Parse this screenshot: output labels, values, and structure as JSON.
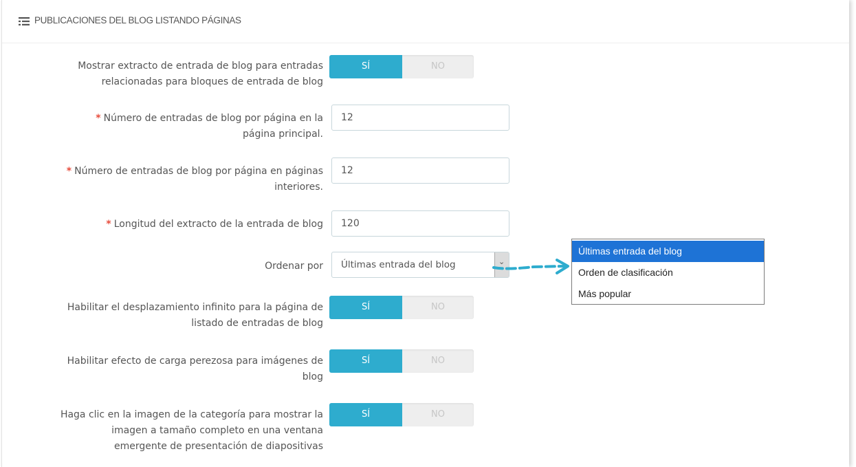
{
  "section": {
    "title": "PUBLICACIONES DEL BLOG LISTANDO PÁGINAS",
    "icon": "list-icon"
  },
  "fields": {
    "excerpt_related": {
      "label_lines": [
        "Mostrar extracto de entrada de blog para entradas",
        "relacionadas para bloques de entrada de blog"
      ],
      "on_label": "SÍ",
      "off_label": "NO",
      "value": "SÍ"
    },
    "posts_per_page_main": {
      "required_mark": "*",
      "label_lines": [
        "Número de entradas de blog por página en la",
        "página principal."
      ],
      "value": "12"
    },
    "posts_per_page_inner": {
      "required_mark": "*",
      "label_lines": [
        "Número de entradas de blog por página en páginas",
        "interiores."
      ],
      "value": "12"
    },
    "excerpt_length": {
      "required_mark": "*",
      "label": "Longitud del extracto de la entrada de blog",
      "value": "120"
    },
    "order_by": {
      "label": "Ordenar por",
      "value": "Últimas entrada del blog",
      "arrow_glyph": "⌄"
    },
    "infinite_scroll": {
      "label_lines": [
        "Habilitar el desplazamiento infinito para la página de",
        "listado de entradas de blog"
      ],
      "on_label": "SÍ",
      "off_label": "NO",
      "value": "SÍ"
    },
    "lazy_load": {
      "label_lines": [
        "Habilitar efecto de carga perezosa para imágenes de",
        "blog"
      ],
      "on_label": "SÍ",
      "off_label": "NO",
      "value": "SÍ"
    },
    "category_image_popup": {
      "label_lines": [
        "Haga clic en la imagen de la categoría para mostrar la",
        "imagen a tamaño completo en una ventana",
        "emergente de presentación de diapositivas"
      ],
      "on_label": "SÍ",
      "off_label": "NO",
      "value": "SÍ"
    }
  },
  "dropdown": {
    "options": [
      "Últimas entrada del blog",
      "Orden de clasificación",
      "Más popular"
    ],
    "selected": "Últimas entrada del blog"
  },
  "colors": {
    "switch_on": "#2eacce",
    "required": "#e74c3c",
    "dropdown_highlight": "#1e73d6",
    "annotation_arrow": "#2eacce"
  }
}
